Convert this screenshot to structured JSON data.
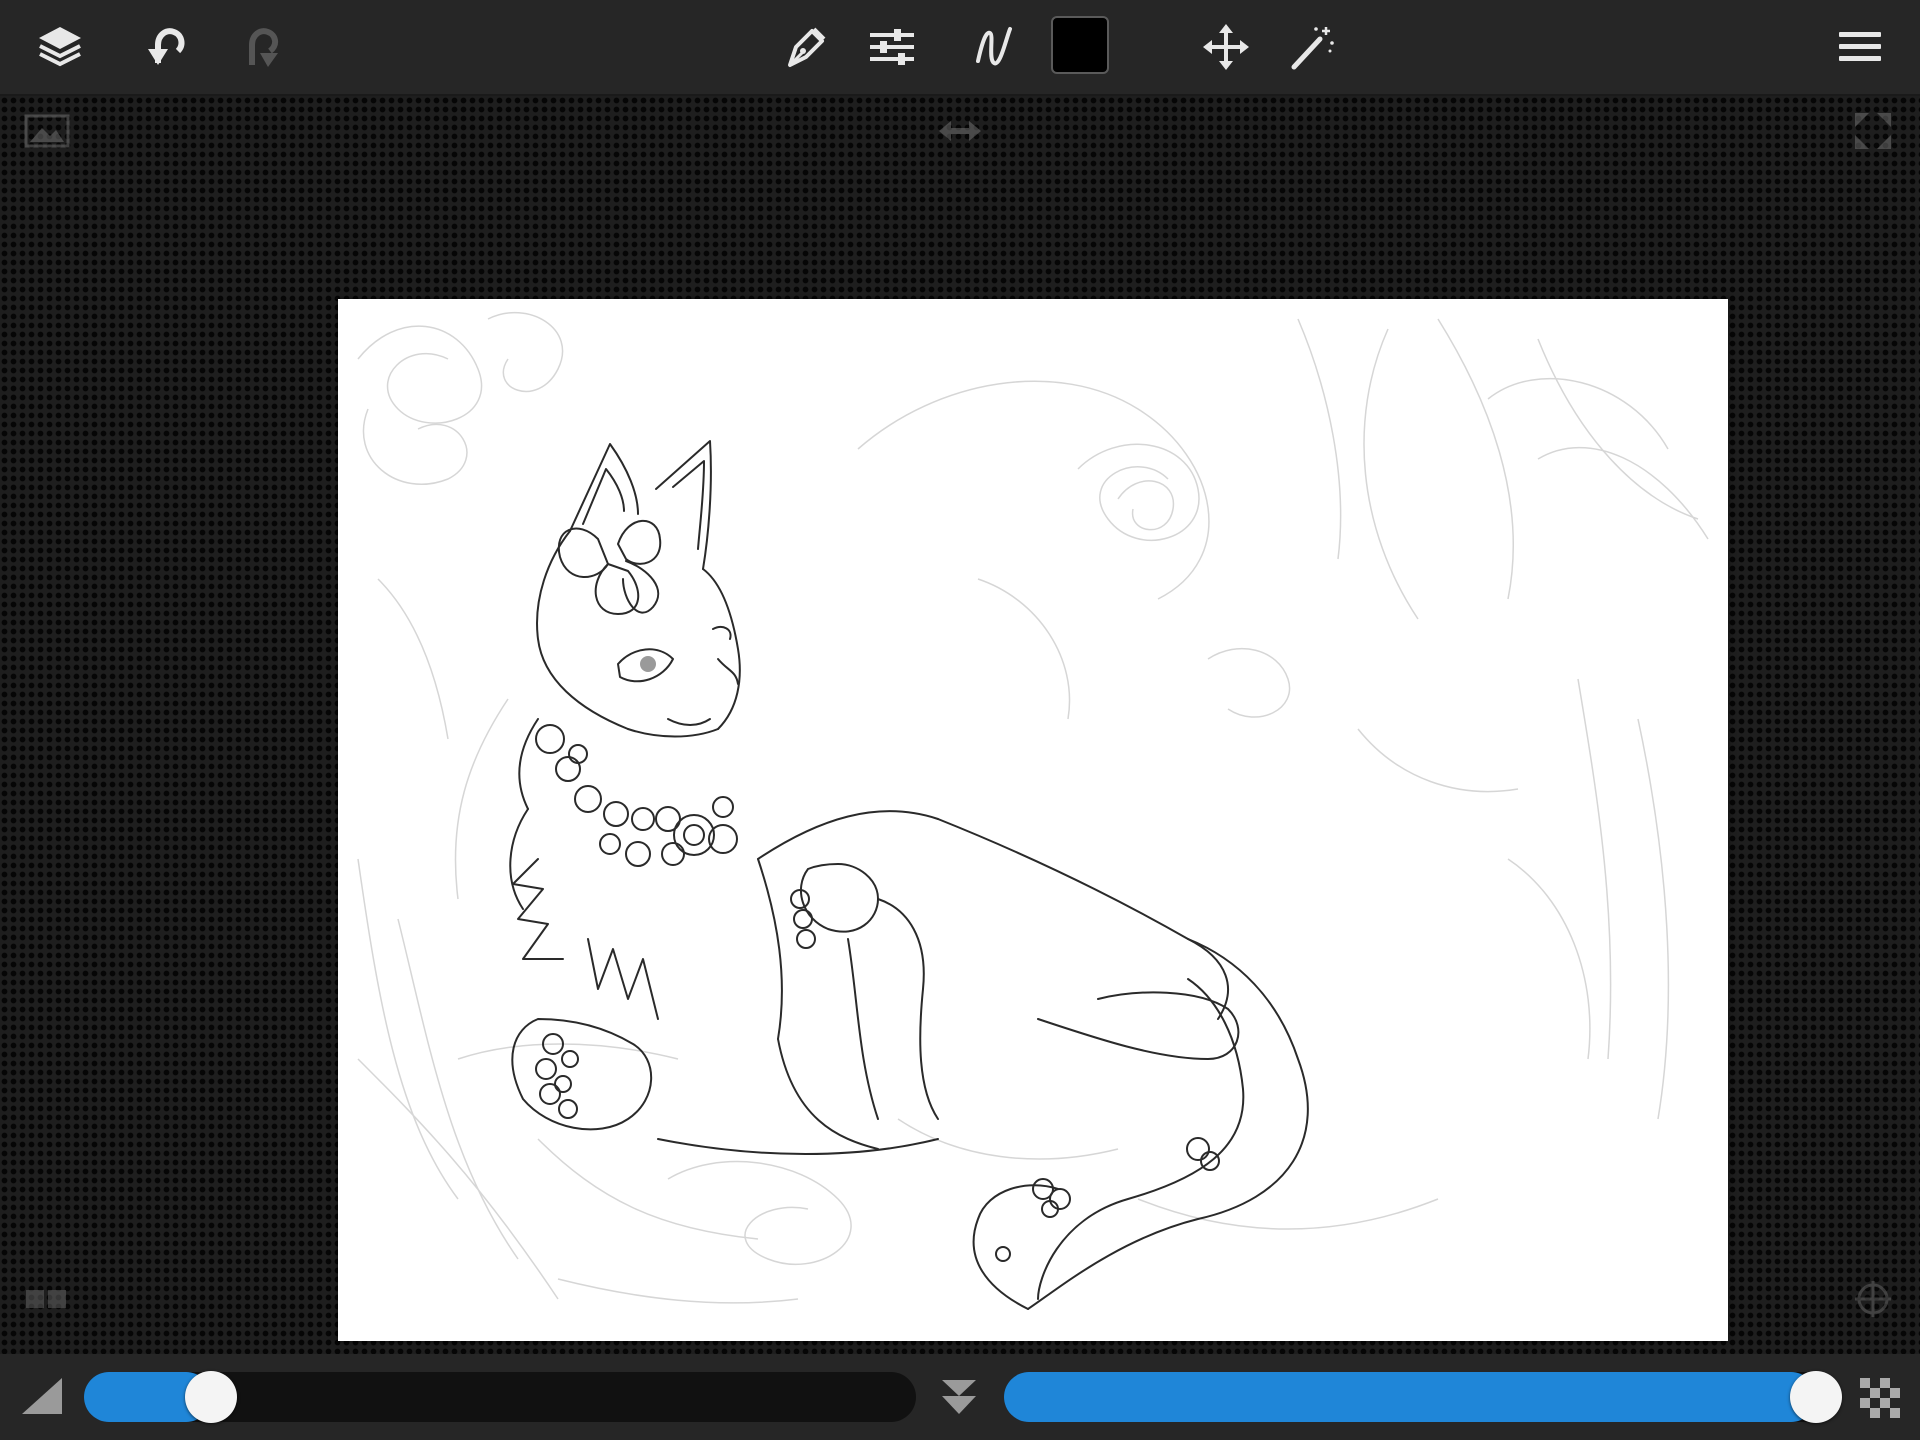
{
  "app": {
    "accent_color": "#1f86d8",
    "toolbar_bg": "#262626"
  },
  "toolbar": {
    "left_icons": [
      "layers-icon",
      "undo-icon",
      "redo-icon"
    ],
    "center_icons": [
      "brush-tool-icon",
      "adjustments-icon",
      "stroke-style-icon",
      "color-swatch",
      "move-icon",
      "magic-wand-icon"
    ],
    "right_icons": [
      "menu-icon"
    ],
    "current_color": "#000000",
    "redo_enabled": false
  },
  "workspace": {
    "corner_icons": [
      "image-reference-icon",
      "flip-canvas-icon",
      "fullscreen-icon",
      "layer-thumbnail-icon",
      "symmetry-icon"
    ],
    "canvas_bg": "#ffffff"
  },
  "bottombar": {
    "brush_size": {
      "icon": "brush-size-icon",
      "level": 0.13
    },
    "center_icon": "collapse-icon",
    "opacity": {
      "icon": "opacity-icon",
      "level": 1.0
    }
  }
}
